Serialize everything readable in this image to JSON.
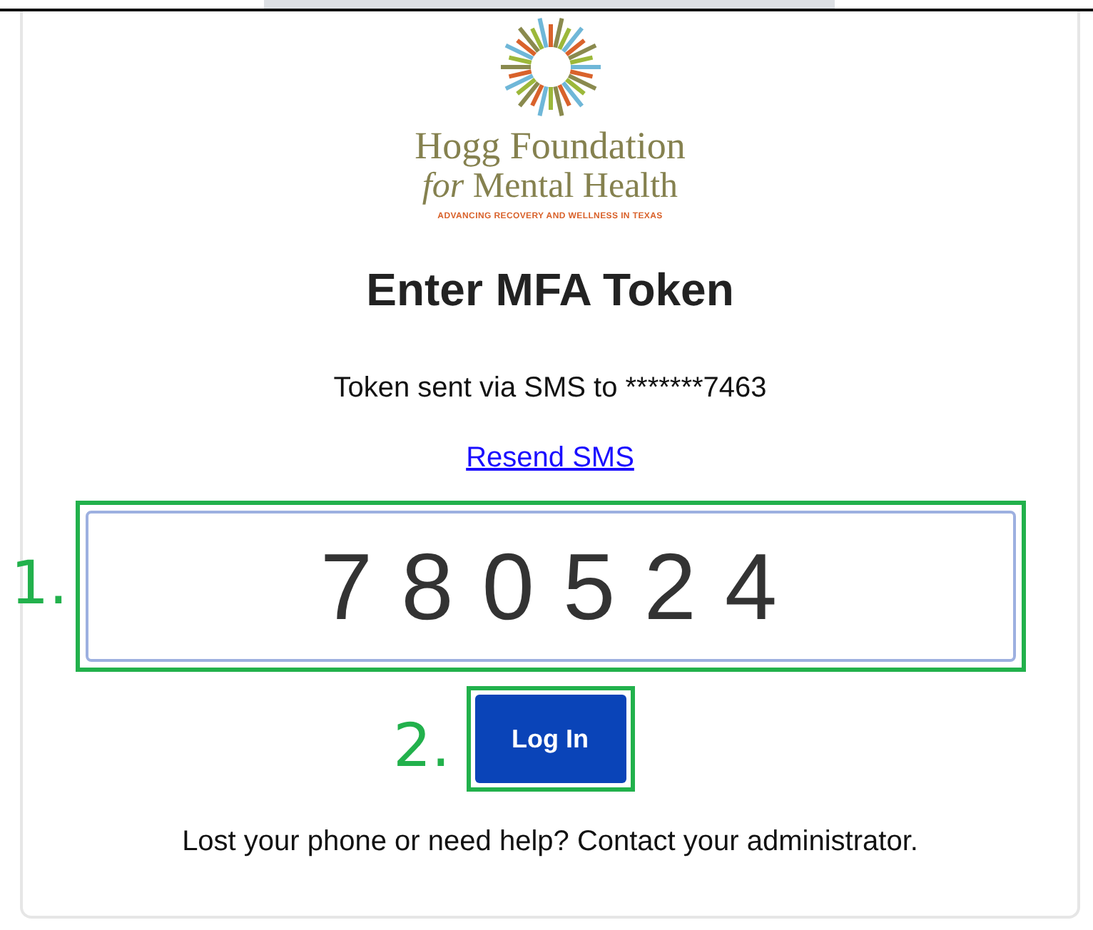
{
  "logo": {
    "line_1": "Hogg Foundation",
    "line_2": "*for* Mental Health",
    "tagline": "ADVANCING RECOVERY AND WELLNESS IN TEXAS"
  },
  "title": "Enter MFA Token",
  "message": "Token sent via SMS to *******7463",
  "resend_link": "Resend SMS",
  "token_field": {
    "value": "780524"
  },
  "login_button": "Log In",
  "help_text": "Lost your phone or need help? Contact your administrator.",
  "annotations": [
    {
      "label": "1."
    },
    {
      "label": "2."
    }
  ]
}
